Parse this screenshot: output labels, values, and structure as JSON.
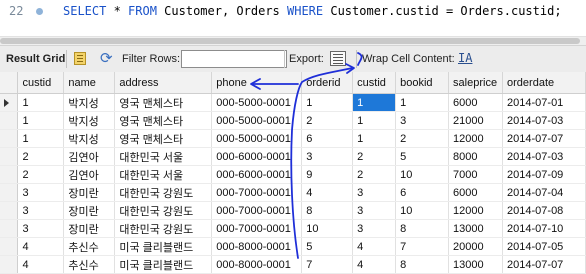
{
  "editor": {
    "line_number": "22",
    "sql_parts": [
      "SELECT",
      " * ",
      "FROM",
      " Customer, Orders ",
      "WHERE",
      " Customer.custid = Orders.custid;"
    ]
  },
  "toolbar": {
    "result_grid_label": "Result Grid",
    "filter_label": "Filter Rows:",
    "filter_value": "",
    "export_label": "Export:",
    "wrap_label": "Wrap Cell Content:",
    "wrap_icon_text": "IA"
  },
  "table": {
    "columns": [
      "custid",
      "name",
      "address",
      "phone",
      "orderid",
      "custid",
      "bookid",
      "saleprice",
      "orderdate"
    ],
    "rows": [
      [
        "1",
        "박지성",
        "영국 맨체스타",
        "000-5000-0001",
        "1",
        "1",
        "1",
        "6000",
        "2014-07-01"
      ],
      [
        "1",
        "박지성",
        "영국 맨체스타",
        "000-5000-0001",
        "2",
        "1",
        "3",
        "21000",
        "2014-07-03"
      ],
      [
        "1",
        "박지성",
        "영국 맨체스타",
        "000-5000-0001",
        "6",
        "1",
        "2",
        "12000",
        "2014-07-07"
      ],
      [
        "2",
        "김연아",
        "대한민국 서울",
        "000-6000-0001",
        "3",
        "2",
        "5",
        "8000",
        "2014-07-03"
      ],
      [
        "2",
        "김연아",
        "대한민국 서울",
        "000-6000-0001",
        "9",
        "2",
        "10",
        "7000",
        "2014-07-09"
      ],
      [
        "3",
        "장미란",
        "대한민국 강원도",
        "000-7000-0001",
        "4",
        "3",
        "6",
        "6000",
        "2014-07-04"
      ],
      [
        "3",
        "장미란",
        "대한민국 강원도",
        "000-7000-0001",
        "8",
        "3",
        "10",
        "12000",
        "2014-07-08"
      ],
      [
        "3",
        "장미란",
        "대한민국 강원도",
        "000-7000-0001",
        "10",
        "3",
        "8",
        "13000",
        "2014-07-10"
      ],
      [
        "4",
        "추신수",
        "미국 클리블랜드",
        "000-8000-0001",
        "5",
        "4",
        "7",
        "20000",
        "2014-07-05"
      ],
      [
        "4",
        "추신수",
        "미국 클리블랜드",
        "000-8000-0001",
        "7",
        "4",
        "8",
        "13000",
        "2014-07-07"
      ]
    ]
  },
  "colors": {
    "selection": "#1e78d8",
    "sql_keyword": "#1a52c9",
    "annotation": "#1f2fd8"
  }
}
